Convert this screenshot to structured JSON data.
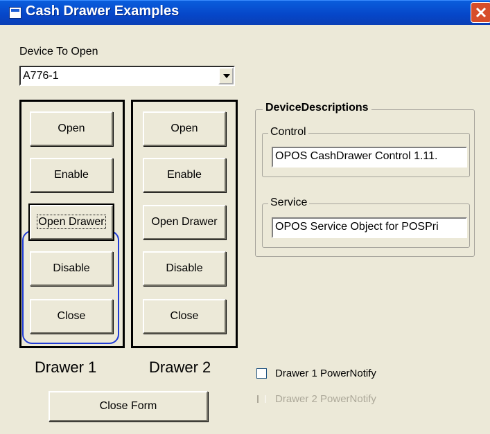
{
  "window": {
    "title": "Cash Drawer Examples"
  },
  "device": {
    "label": "Device To Open",
    "value": "A776-1"
  },
  "drawer1": {
    "buttons": [
      "Open",
      "Enable",
      "Open Drawer",
      "Disable",
      "Close"
    ],
    "label": "Drawer 1"
  },
  "drawer2": {
    "buttons": [
      "Open",
      "Enable",
      "Open Drawer",
      "Disable",
      "Close"
    ],
    "label": "Drawer 2"
  },
  "close_form": "Close Form",
  "descriptions": {
    "title": "DeviceDescriptions",
    "control_label": "Control",
    "control_value": "OPOS CashDrawer Control 1.11.",
    "service_label": "Service",
    "service_value": "OPOS Service Object for POSPri"
  },
  "power_notify": {
    "drawer1": "Drawer 1 PowerNotify",
    "drawer2": "Drawer 2 PowerNotify"
  },
  "icons": [
    "app-icon",
    "close-icon",
    "dropdown-arrow-icon"
  ],
  "colors": {
    "titlebar": "#0646c8",
    "close": "#d74d2a",
    "focus_ring": "#1f3bd6",
    "background": "#ece9d8"
  }
}
